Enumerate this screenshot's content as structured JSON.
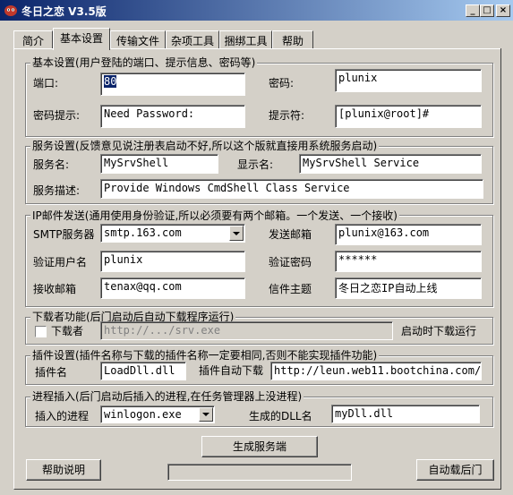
{
  "window": {
    "title": "冬日之恋 V3.5版",
    "min": "_",
    "max": "□",
    "close": "×"
  },
  "tabs": [
    "简介",
    "基本设置",
    "传输文件",
    "杂项工具",
    "捆绑工具",
    "帮助"
  ],
  "basic": {
    "title": "基本设置(用户登陆的端口、提示信息、密码等)",
    "port_label": "端口:",
    "port_value": "80",
    "password_label": "密码:",
    "password_value": "plunix",
    "hint_label": "密码提示:",
    "hint_value": "Need Password:",
    "prompt_label": "提示符:",
    "prompt_value": "[plunix@root]#"
  },
  "service": {
    "title": "服务设置(反馈意见说注册表启动不好,所以这个版就直接用系统服务启动)",
    "name_label": "服务名:",
    "name_value": "MySrvShell",
    "display_label": "显示名:",
    "display_value": "MySrvShell Service",
    "desc_label": "服务描述:",
    "desc_value": "Provide Windows CmdShell Class Service"
  },
  "mail": {
    "title": "IP邮件发送(通用使用身份验证,所以必须要有两个邮箱。一个发送、一个接收)",
    "smtp_label": "SMTP服务器",
    "smtp_value": "smtp.163.com",
    "sender_label": "发送邮箱",
    "sender_value": "plunix@163.com",
    "user_label": "验证用户名",
    "user_value": "plunix",
    "pass_label": "验证密码",
    "pass_value": "******",
    "recv_label": "接收邮箱",
    "recv_value": "tenax@qq.com",
    "subject_label": "信件主题",
    "subject_value": "冬日之恋IP自动上线"
  },
  "downloader": {
    "title": "下载者功能(后门启动后自动下载程序运行)",
    "check_label": "下载者",
    "url_value": "http://.../srv.exe",
    "note": "启动时下载运行"
  },
  "plugin": {
    "title": "插件设置(插件名称与下载的插件名称一定要相同,否则不能实现插件功能)",
    "name_label": "插件名",
    "name_value": "LoadDll.dll",
    "auto_label": "插件自动下载",
    "auto_value": "http://leun.web11.bootchina.com/"
  },
  "inject": {
    "title": "进程插入(后门启动后插入的进程,在任务管理器上没进程)",
    "proc_label": "插入的进程",
    "proc_value": "winlogon.exe",
    "dll_label": "生成的DLL名",
    "dll_value": "myDll.dll"
  },
  "buttons": {
    "generate": "生成服务端",
    "help": "帮助说明",
    "self_load": "自动载后门"
  },
  "progress": 0
}
